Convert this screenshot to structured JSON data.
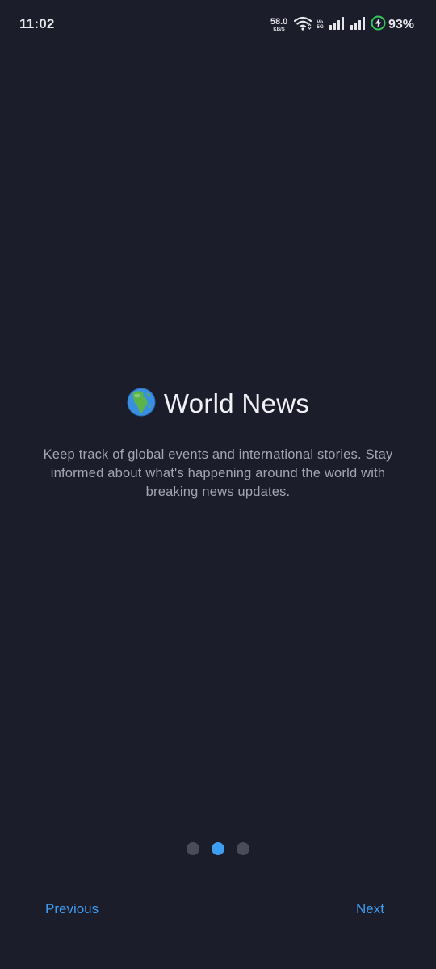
{
  "status_bar": {
    "time": "11:02",
    "net_speed_value": "58.0",
    "net_speed_unit": "KB/S",
    "volte_top": "Vo",
    "volte_bottom": "5G",
    "battery_percent": "93%",
    "icons": [
      "wifi-icon",
      "signal-icon",
      "signal-icon",
      "battery-charging-icon"
    ]
  },
  "onboarding": {
    "icon": "globe-africa-icon",
    "title": "World News",
    "description": "Keep track of global events and international stories. Stay informed about what's happening around the world with breaking news updates.",
    "pages_total": 3,
    "current_page": 2
  },
  "navigation": {
    "previous_label": "Previous",
    "next_label": "Next"
  },
  "colors": {
    "background": "#1b1d2a",
    "accent": "#3d9df0",
    "inactive_dot": "#4a4c58",
    "description_text": "#a3a5b3"
  }
}
